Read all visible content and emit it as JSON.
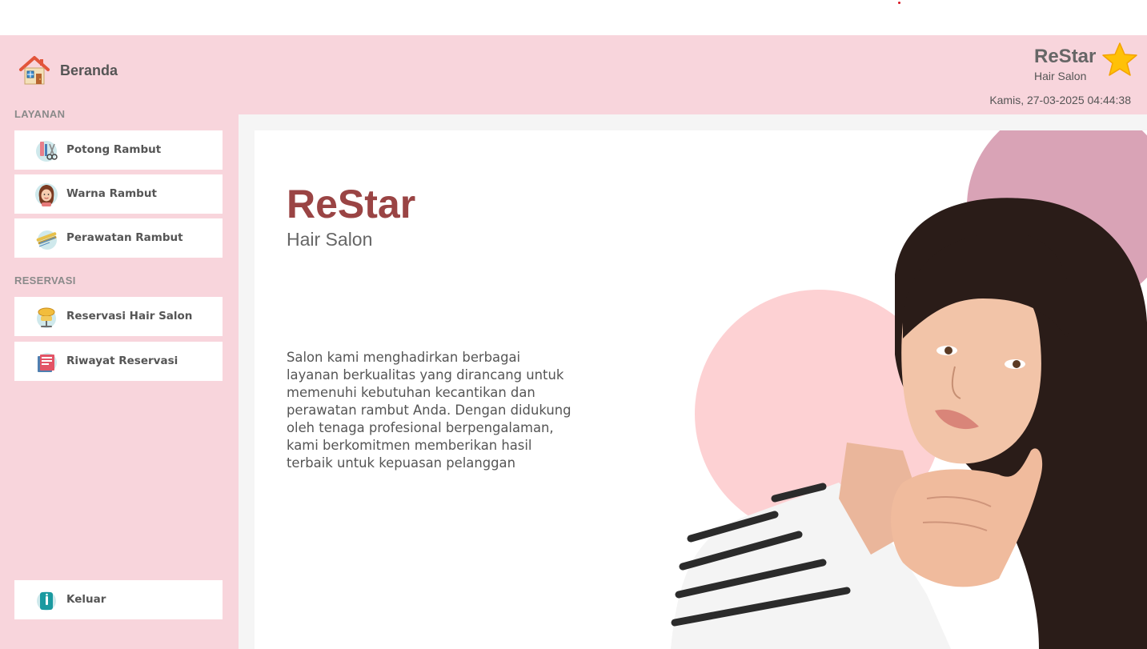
{
  "header": {
    "home_label": "Beranda",
    "home_icon": "house-icon",
    "brand_name": "ReStar",
    "brand_sub": "Hair Salon",
    "brand_icon": "star-icon",
    "datetime": "Kamis, 27-03-2025 04:44:38"
  },
  "sidebar": {
    "layanan_label": "LAYANAN",
    "reservasi_label": "RESERVASI",
    "layanan_items": [
      {
        "label": "Potong Rambut",
        "icon": "hair-cutting-icon"
      },
      {
        "label": "Warna Rambut",
        "icon": "hair-color-icon"
      },
      {
        "label": "Perawatan Rambut",
        "icon": "hair-treatment-icon"
      }
    ],
    "reservasi_items": [
      {
        "label": "Reservasi Hair Salon",
        "icon": "salon-chair-icon"
      },
      {
        "label": "Riwayat Reservasi",
        "icon": "history-book-icon"
      }
    ],
    "logout_label": "Keluar",
    "logout_icon": "logout-door-icon"
  },
  "main": {
    "title": "ReStar",
    "subtitle": "Hair Salon",
    "description": "Salon kami menghadirkan berbagai layanan berkualitas yang dirancang untuk memenuhi kebutuhan kecantikan dan perawatan rambut Anda. Dengan didukung oleh tenaga profesional berpengalaman, kami berkomitmen memberikan hasil terbaik untuk kepuasan pelanggan"
  },
  "colors": {
    "app_background": "#f8d5dc",
    "title_color": "#9a4444",
    "accent_circle_1": "#d9a3b6",
    "accent_circle_2": "#fdd1d3",
    "star": "#ffc107"
  }
}
